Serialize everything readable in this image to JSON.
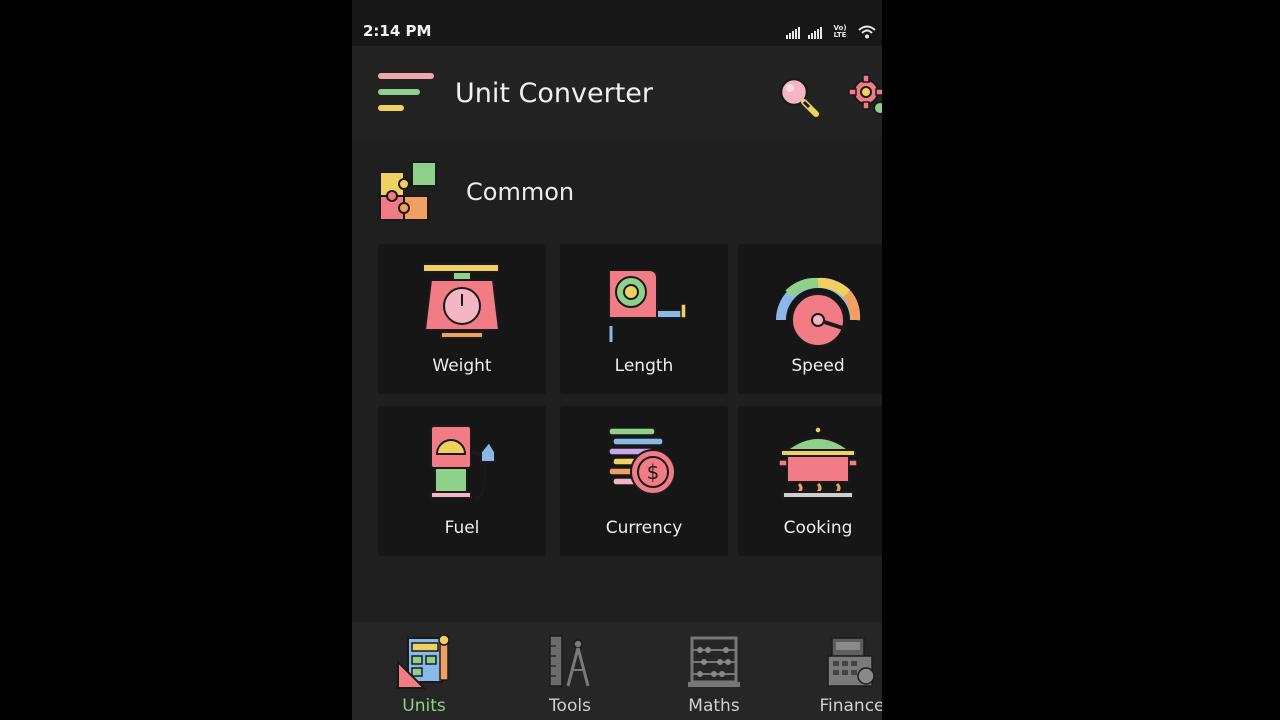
{
  "status_bar": {
    "time": "2:14 PM",
    "network_label": "Vo) LTE"
  },
  "app_bar": {
    "title": "Unit Converter"
  },
  "section": {
    "title": "Common"
  },
  "categories": [
    {
      "label": "Weight",
      "icon": "weight-scale-icon"
    },
    {
      "label": "Length",
      "icon": "tape-measure-icon"
    },
    {
      "label": "Speed",
      "icon": "speedometer-icon"
    },
    {
      "label": "Fuel",
      "icon": "fuel-pump-icon"
    },
    {
      "label": "Currency",
      "icon": "currency-coins-icon"
    },
    {
      "label": "Cooking",
      "icon": "cooking-pot-icon"
    }
  ],
  "bottom_nav": [
    {
      "label": "Units",
      "active": true
    },
    {
      "label": "Tools",
      "active": false
    },
    {
      "label": "Maths",
      "active": false
    },
    {
      "label": "Finance",
      "active": false
    }
  ],
  "colors": {
    "background": "#1f1f1f",
    "tile": "#161616",
    "accent_green": "#8fd18a",
    "pink": "#f27c85",
    "yellow": "#f0d060",
    "blue": "#8ab8e8"
  }
}
